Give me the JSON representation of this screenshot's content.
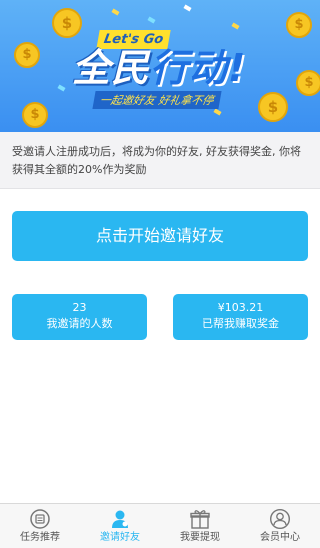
{
  "banner": {
    "badge": "Let's Go",
    "headline_part1": "全民",
    "headline_part2": "行动!",
    "subline": "一起邀好友 好礼拿不停"
  },
  "description": "受邀请人注册成功后，将成为你的好友, 好友获得奖金, 你将获得其全额的20%作为奖励",
  "invite_button": "点击开始邀请好友",
  "stats": {
    "invited_count": "23",
    "invited_label": "我邀请的人数",
    "reward_amount": "¥103.21",
    "reward_label": "已帮我赚取奖金"
  },
  "tabs": [
    {
      "label": "任务推荐",
      "icon": "task-icon",
      "active": false
    },
    {
      "label": "邀请好友",
      "icon": "user-icon",
      "active": true
    },
    {
      "label": "我要提现",
      "icon": "gift-icon",
      "active": false
    },
    {
      "label": "会员中心",
      "icon": "profile-icon",
      "active": false
    }
  ],
  "colors": {
    "accent": "#2ab7f1",
    "banner_top": "#5fb2f7",
    "banner_bottom": "#3a8ff1",
    "coin": "#f7c623"
  }
}
